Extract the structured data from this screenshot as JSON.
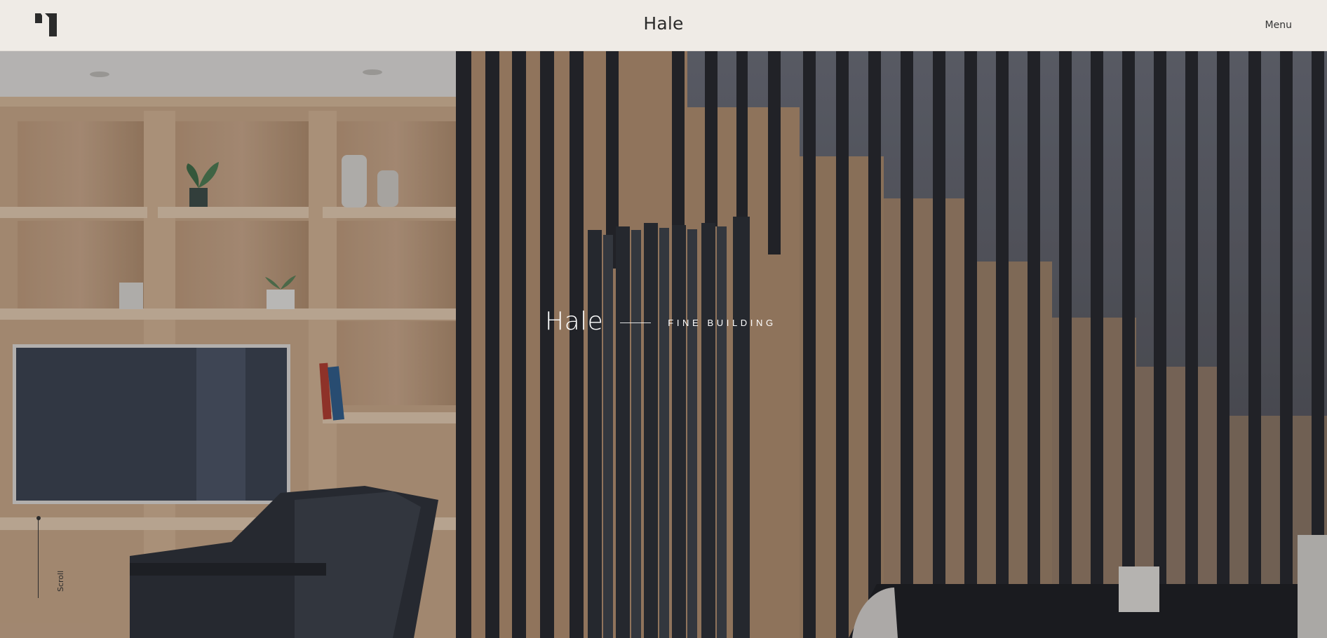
{
  "header": {
    "logo_icon": "hale-logo-icon",
    "title": "Hale",
    "menu_label": "Menu"
  },
  "hero": {
    "title": "Hale",
    "tagline": "FINE BUILDING",
    "scroll_label": "Scroll"
  },
  "colors": {
    "background": "#efebe6",
    "text_dark": "#2b2b2b",
    "text_light": "#ffffff"
  }
}
